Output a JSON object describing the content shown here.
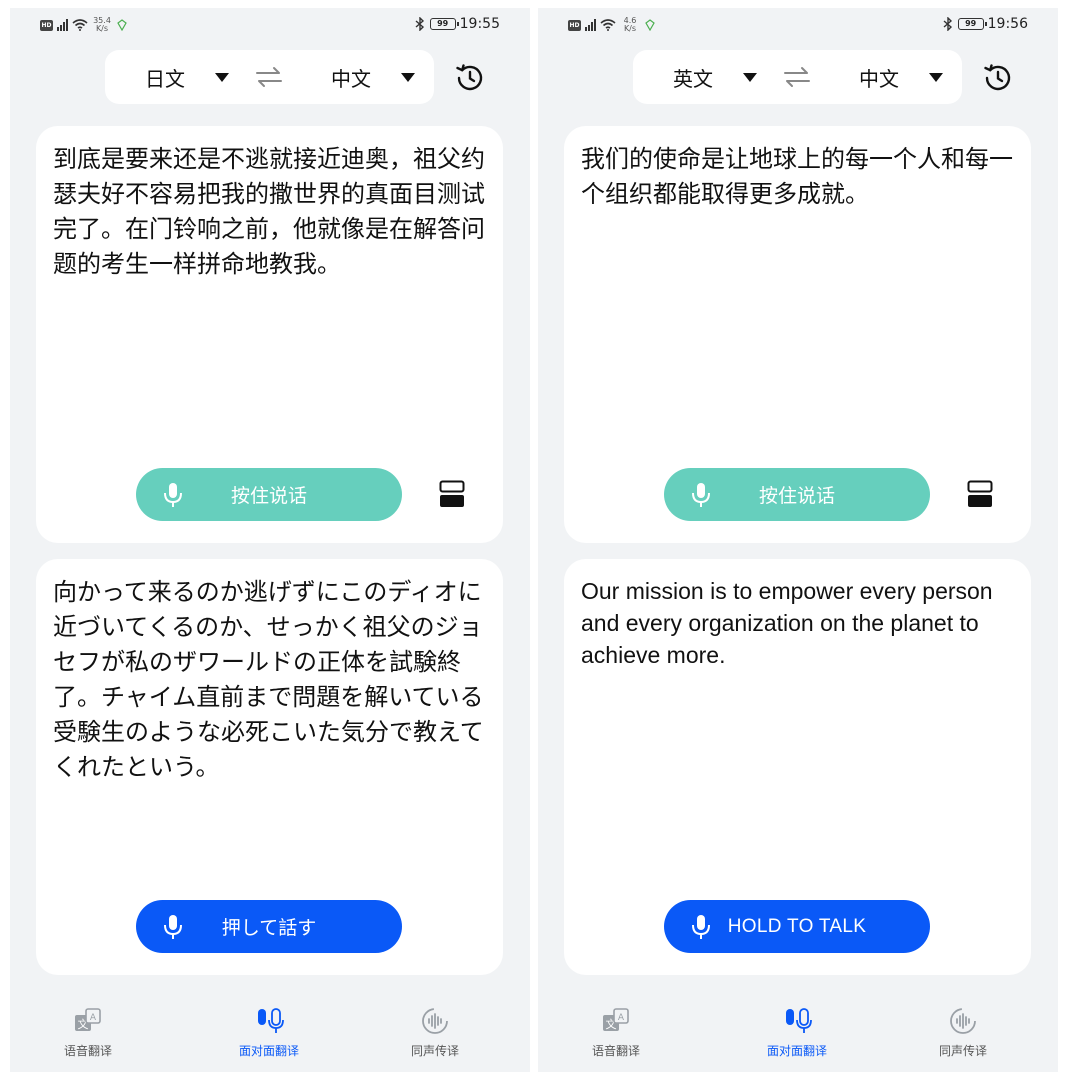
{
  "colors": {
    "accent": "#0a59f7",
    "teal_button": "#66cfbd",
    "background": "#f1f3f5",
    "card": "#ffffff"
  },
  "screens": [
    {
      "status": {
        "net_speed_value": "35.4",
        "net_speed_unit": "K/s",
        "battery": "99",
        "time": "19:55"
      },
      "language_bar": {
        "source": "日文",
        "target": "中文"
      },
      "top_card": {
        "text": "到底是要来还是不逃就接近迪奥，祖父约瑟夫好不容易把我的撒世界的真面目测试完了。在门铃响之前，他就像是在解答问题的考生一样拼命地教我。",
        "button_label": "按住说话"
      },
      "bottom_card": {
        "text": "向かって来るのか逃げずにこのディオに近づいてくるのか、せっかく祖父のジョセフが私のザワールドの正体を試験終了。チャイム直前まで問題を解いている受験生のような必死こいた気分で教えてくれたという。",
        "button_label": "押して話す"
      },
      "nav": {
        "items": [
          {
            "label": "语音翻译",
            "icon": "text-translate-icon"
          },
          {
            "label": "面对面翻译",
            "icon": "dual-mic-icon"
          },
          {
            "label": "同声传译",
            "icon": "simultaneous-interpret-icon"
          }
        ],
        "active_index": 1
      }
    },
    {
      "status": {
        "net_speed_value": "4.6",
        "net_speed_unit": "K/s",
        "battery": "99",
        "time": "19:56"
      },
      "language_bar": {
        "source": "英文",
        "target": "中文"
      },
      "top_card": {
        "text": "我们的使命是让地球上的每一个人和每一个组织都能取得更多成就。",
        "button_label": "按住说话"
      },
      "bottom_card": {
        "text": "Our mission is to empower every person and every organization on the planet to achieve more.",
        "button_label": "HOLD TO TALK"
      },
      "nav": {
        "items": [
          {
            "label": "语音翻译",
            "icon": "text-translate-icon"
          },
          {
            "label": "面对面翻译",
            "icon": "dual-mic-icon"
          },
          {
            "label": "同声传译",
            "icon": "simultaneous-interpret-icon"
          }
        ],
        "active_index": 1
      }
    }
  ]
}
